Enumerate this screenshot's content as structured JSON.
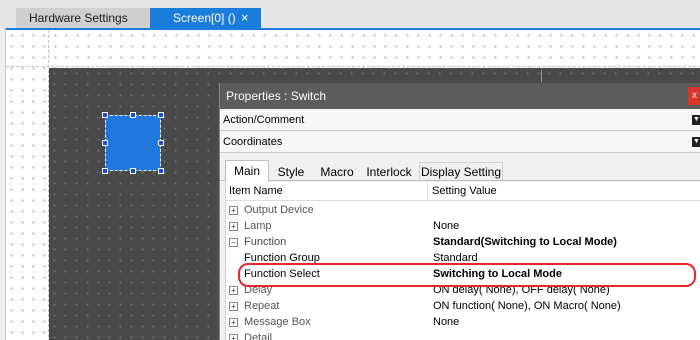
{
  "tabs": {
    "hardware_settings": "Hardware Settings",
    "screen": "Screen[0] ()",
    "close_glyph": "×"
  },
  "properties": {
    "title": "Properties : Switch",
    "close_glyph": "x",
    "sections": {
      "action_comment": "Action/Comment",
      "coordinates": "Coordinates"
    },
    "subtabs": [
      "Main",
      "Style",
      "Macro",
      "Interlock",
      "Display Setting"
    ],
    "grid": {
      "columns": [
        "Item Name",
        "Setting Value"
      ],
      "rows": [
        {
          "expander": "+",
          "name": "Output Device",
          "value": ""
        },
        {
          "expander": "+",
          "name": "Lamp",
          "value": "None"
        },
        {
          "expander": "−",
          "name": "Function",
          "value": "Standard(Switching to Local Mode)"
        },
        {
          "expander": "",
          "name": "Function Group",
          "value": "Standard"
        },
        {
          "expander": "",
          "name": "Function Select",
          "value": "Switching to Local Mode"
        },
        {
          "expander": "+",
          "name": "Delay",
          "value": "ON delay( None), OFF delay( None)"
        },
        {
          "expander": "+",
          "name": "Repeat",
          "value": "ON function( None), ON Macro( None)"
        },
        {
          "expander": "+",
          "name": "Message Box",
          "value": "None"
        },
        {
          "expander": "+",
          "name": "Detail",
          "value": ""
        }
      ]
    }
  },
  "colors": {
    "accent": "#1a7ddb",
    "switch_fill": "#2277dd",
    "highlight": "#e8262a",
    "panel_title": "#5c5c5c"
  }
}
